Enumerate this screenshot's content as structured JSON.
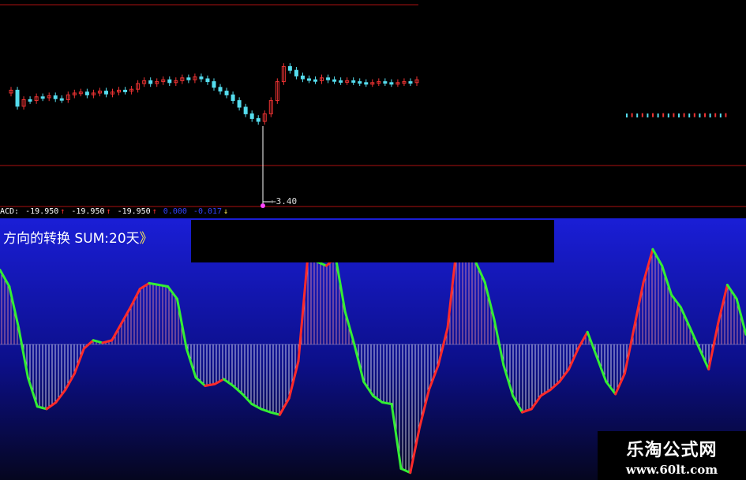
{
  "indicator": {
    "title": "方向的转换",
    "sum_label": "SUM:20天",
    "bracket": "》"
  },
  "acd_row": {
    "prefix": "ACD:",
    "v1": "-19.950",
    "a1": "↑",
    "v2": "-19.950",
    "a2": "↑",
    "v3": "-19.950",
    "a3": "↑",
    "v4": "0.000",
    "v5": "-0.017",
    "a4": "↓"
  },
  "price": {
    "low_label": "3.40"
  },
  "watermark": {
    "title": "乐淘公式网",
    "url": "www.60lt.com"
  },
  "colors": {
    "up": "#ee3333",
    "down": "#55ddee",
    "rise_line": "#ff2a2a",
    "fall_line": "#33ee33",
    "hist": "#ffffff",
    "grid": "#aa1111"
  },
  "chart_data": [
    {
      "type": "candlestick",
      "title": "",
      "low_marker": 3.4,
      "close": [
        0.63,
        0.46,
        0.53,
        0.52,
        0.56,
        0.55,
        0.57,
        0.54,
        0.53,
        0.58,
        0.6,
        0.61,
        0.58,
        0.6,
        0.62,
        0.59,
        0.61,
        0.63,
        0.62,
        0.64,
        0.7,
        0.73,
        0.7,
        0.72,
        0.74,
        0.71,
        0.73,
        0.76,
        0.74,
        0.77,
        0.75,
        0.72,
        0.66,
        0.62,
        0.58,
        0.52,
        0.45,
        0.38,
        0.33,
        0.3,
        0.38,
        0.52,
        0.72,
        0.88,
        0.84,
        0.78,
        0.75,
        0.74,
        0.73,
        0.76,
        0.74,
        0.73,
        0.72,
        0.73,
        0.72,
        0.71,
        0.7,
        0.71,
        0.72,
        0.71,
        0.7,
        0.71,
        0.72,
        0.71,
        0.74
      ],
      "trailing_small_segment": [
        0.55,
        0.56,
        0.55,
        0.56,
        0.55,
        0.56,
        0.55,
        0.56,
        0.55,
        0.56,
        0.55,
        0.56,
        0.55,
        0.56,
        0.55,
        0.56,
        0.55,
        0.56,
        0.55,
        0.56
      ]
    },
    {
      "type": "line",
      "title": "方向的转换 SUM:20天",
      "zero_line": 0,
      "series": [
        {
          "values": [
            0.9,
            0.7,
            0.2,
            -0.4,
            -0.75,
            -0.78,
            -0.7,
            -0.55,
            -0.35,
            -0.05,
            0.05,
            0.02,
            0.05,
            0.25,
            0.45,
            0.67,
            0.74,
            0.72,
            0.7,
            0.55,
            -0.05,
            -0.4,
            -0.5,
            -0.48,
            -0.42,
            -0.5,
            -0.6,
            -0.72,
            -0.78,
            -0.82,
            -0.85,
            -0.65,
            -0.2,
            1.05,
            1.0,
            0.95,
            1.05,
            0.4,
            0.0,
            -0.45,
            -0.62,
            -0.7,
            -0.72,
            -1.5,
            -1.55,
            -1.0,
            -0.55,
            -0.25,
            0.2,
            1.2,
            1.25,
            1.0,
            0.75,
            0.3,
            -0.25,
            -0.62,
            -0.82,
            -0.78,
            -0.62,
            -0.55,
            -0.45,
            -0.3,
            -0.05,
            0.15,
            -0.15,
            -0.45,
            -0.6,
            -0.35,
            0.2,
            0.75,
            1.15,
            0.95,
            0.6,
            0.45,
            0.2,
            -0.05,
            -0.3,
            0.25,
            0.72,
            0.55,
            0.12
          ]
        }
      ]
    }
  ]
}
